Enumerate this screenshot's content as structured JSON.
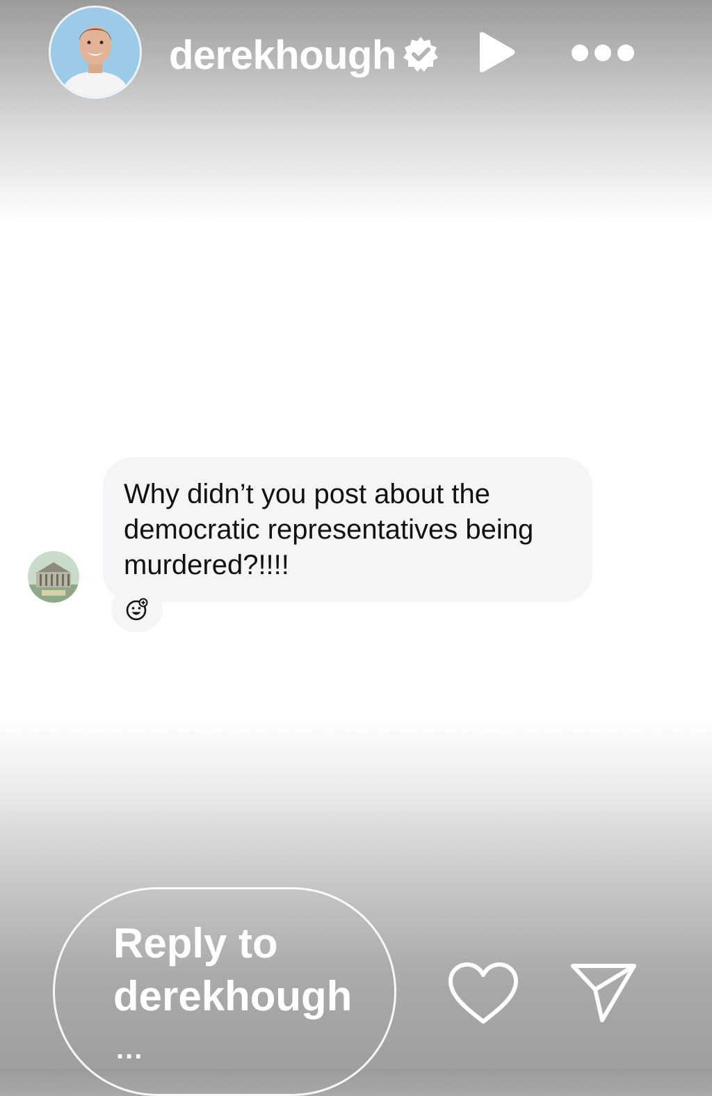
{
  "header": {
    "username": "derekhough",
    "verified": true,
    "avatar": "profile-photo-man",
    "icons": {
      "verified": "verified-badge-icon",
      "play": "play-icon",
      "more": "more-options-icon"
    }
  },
  "comment": {
    "avatar": "building-photo",
    "text": "Why didn’t you post about the democratic representatives being murdered?!!!!",
    "reaction_icon": "add-reaction-icon",
    "bubble_color": "#f5f5f7"
  },
  "reply": {
    "placeholder": "Reply to derekhough",
    "truncation": "..."
  },
  "actions": {
    "like_icon": "heart-icon",
    "send_icon": "send-icon"
  },
  "colors": {
    "header_fg": "#ffffff",
    "text": "#111111",
    "gradient_top": "#9b9b9b",
    "gradient_mid": "#ffffff",
    "gradient_bottom": "#9f9f9f"
  }
}
